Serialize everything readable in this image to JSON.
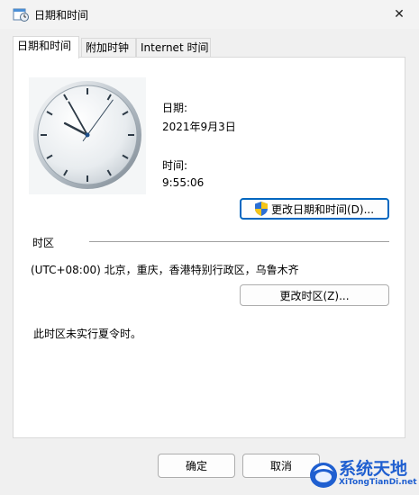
{
  "window": {
    "title": "日期和时间",
    "close_glyph": "✕"
  },
  "tabs": [
    {
      "label": "日期和时间",
      "active": true
    },
    {
      "label": "附加时钟",
      "active": false
    },
    {
      "label": "Internet 时间",
      "active": false
    }
  ],
  "date_time": {
    "date_label": "日期:",
    "date_value": "2021年9月3日",
    "time_label": "时间:",
    "time_value": "9:55:06",
    "change_button_label": "更改日期和时间(D)..."
  },
  "clock": {
    "hour": 9,
    "minute": 55,
    "second": 6
  },
  "timezone": {
    "section_label": "时区",
    "value": "(UTC+08:00) 北京，重庆，香港特别行政区，乌鲁木齐",
    "change_button_label": "更改时区(Z)...",
    "dst_note": "此时区未实行夏令时。"
  },
  "footer": {
    "ok_label": "确定",
    "cancel_label": "取消"
  },
  "watermark": {
    "title": "系统天地",
    "url": "XiTongTianDi.net"
  },
  "colors": {
    "accent": "#0067c0",
    "watermark": "#1f5fd0"
  }
}
